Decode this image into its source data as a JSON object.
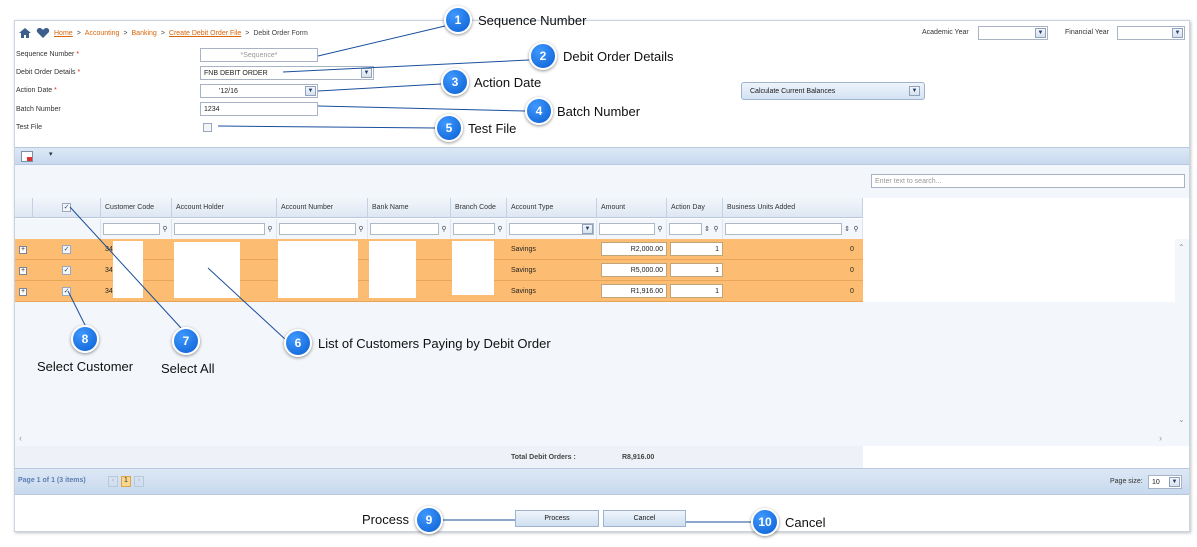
{
  "breadcrumb": {
    "home": "Home",
    "sep": ">",
    "accounting": "Accounting",
    "banking": "Banking",
    "create": "Create Debit Order File",
    "current": "Debit Order Form"
  },
  "header_filters": {
    "academic_year_label": "Academic Year",
    "financial_year_label": "Financial Year"
  },
  "form": {
    "sequence_label": "Sequence Number",
    "sequence_placeholder": "*Sequence*",
    "details_label": "Debit Order Details",
    "details_value": "FNB DEBIT ORDER",
    "action_date_label": "Action Date",
    "action_date_value": "'12/16",
    "batch_label": "Batch Number",
    "batch_value": "1234",
    "test_file_label": "Test File",
    "required_mark": "*"
  },
  "calc_button": "Calculate Current Balances",
  "search_placeholder": "Enter text to search...",
  "grid": {
    "columns": [
      "Customer Code",
      "Account Holder",
      "Account Number",
      "Bank Name",
      "Branch Code",
      "Account Type",
      "Amount",
      "Action Day",
      "Business Units Added"
    ],
    "rows": [
      {
        "code": "34",
        "account_type": "Savings",
        "amount": "R2,000.00",
        "action_day": "1",
        "units": "0"
      },
      {
        "code": "34",
        "account_type": "Savings",
        "amount": "R5,000.00",
        "action_day": "1",
        "units": "0"
      },
      {
        "code": "34",
        "account_type": "Savings",
        "amount": "R1,916.00",
        "action_day": "1",
        "units": "0"
      }
    ],
    "total_label": "Total Debit Orders :",
    "total_value": "R8,916.00"
  },
  "pager": {
    "summary": "Page 1 of 1 (3 items)",
    "current_page": "1",
    "page_size_label": "Page size:",
    "page_size": "10"
  },
  "buttons": {
    "process": "Process",
    "cancel": "Cancel"
  },
  "callouts": [
    {
      "num": "1",
      "label": "Sequence Number"
    },
    {
      "num": "2",
      "label": "Debit Order Details"
    },
    {
      "num": "3",
      "label": "Action Date"
    },
    {
      "num": "4",
      "label": "Batch Number"
    },
    {
      "num": "5",
      "label": "Test File"
    },
    {
      "num": "6",
      "label": "List of Customers Paying by Debit Order"
    },
    {
      "num": "7",
      "label": "Select All"
    },
    {
      "num": "8",
      "label": "Select Customer"
    },
    {
      "num": "9",
      "label": "Process"
    },
    {
      "num": "10",
      "label": "Cancel"
    }
  ],
  "colors": {
    "row_highlight": "#fcbd72",
    "callout_blue": "#1f7ae8",
    "link_orange": "#d8660b"
  }
}
